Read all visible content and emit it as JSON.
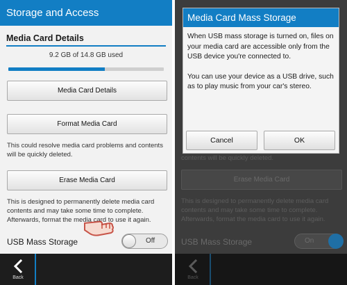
{
  "left": {
    "title": "Storage and Access",
    "section_heading": "Media Card Details",
    "usage_text": "9.2 GB of 14.8 GB used",
    "usage_fraction": 0.62,
    "buttons": {
      "details": "Media Card Details",
      "format": "Format Media Card",
      "erase": "Erase Media Card"
    },
    "format_desc": "This could resolve media card problems and contents will be quickly deleted.",
    "erase_desc": "This is designed to permanently delete media card contents and may take some time to complete. Afterwards, format the media card to use it again.",
    "usb_label": "USB Mass Storage",
    "usb_toggle_state": "Off",
    "back_label": "Back"
  },
  "right": {
    "dialog": {
      "title": "Media Card Mass Storage",
      "body_1": "When USB mass storage is turned on, files on your media card are accessible only from the USB device you're connected to.",
      "body_2": "You can use your device as a USB drive, such as to play music from your car's stereo.",
      "cancel_label": "Cancel",
      "ok_label": "OK"
    },
    "ghost_partial_text": "contents will be quickly deleted.",
    "ghost_erase": "Erase Media Card",
    "ghost_desc": "This is designed to permanently delete media card contents and may take some time to complete. Afterwards, format the media card to use it again.",
    "ghost_usb_label": "USB Mass Storage",
    "ghost_toggle_state": "On"
  },
  "colors": {
    "accent": "#127ec4",
    "bar": "#1d1d1d"
  },
  "icons": {
    "back": "chevron-left-icon",
    "pointer": "pointing-hand-icon"
  }
}
